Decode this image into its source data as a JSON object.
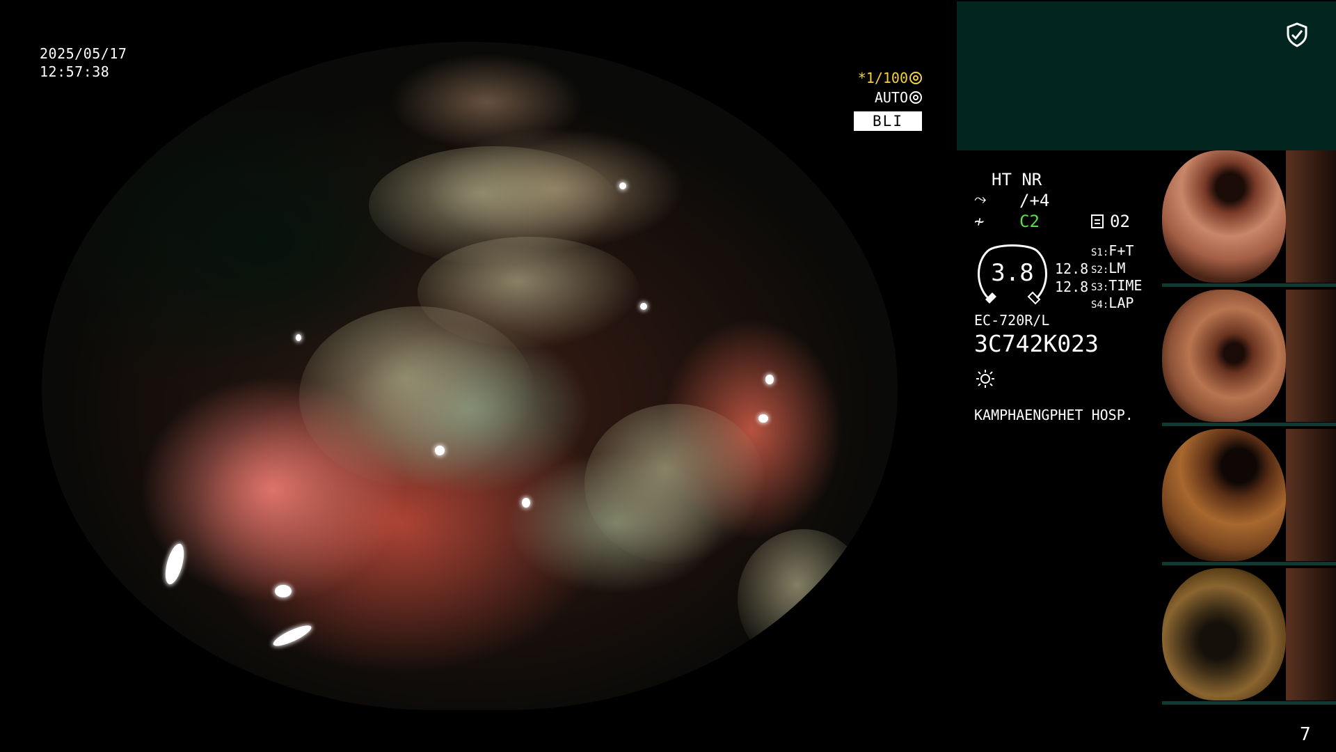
{
  "datetime": {
    "date": "2025/05/17",
    "time": "12:57:38"
  },
  "scope_overlay": {
    "shutter": "*1/100",
    "mode": "AUTO",
    "light_mode": "BLI"
  },
  "info": {
    "ht_nr": "HT NR",
    "enhancement": "/+4",
    "color_setting": "C2",
    "switch_number": "02",
    "gauge_value": "3.8",
    "mag_a": "12.8",
    "mag_b": "12.8",
    "switches": [
      {
        "key": "S1",
        "value": "F+T"
      },
      {
        "key": "S2",
        "value": "LM"
      },
      {
        "key": "S3",
        "value": "TIME"
      },
      {
        "key": "S4",
        "value": "LAP"
      }
    ],
    "scope_model": "EC-720R/L",
    "scope_serial": "3C742K023",
    "hospital": "KAMPHAENGPHET HOSP."
  },
  "thumbnails": [
    {
      "name": "capture-1"
    },
    {
      "name": "capture-2"
    },
    {
      "name": "capture-3"
    },
    {
      "name": "capture-4"
    }
  ],
  "page_number": "7",
  "colors": {
    "panel_bg": "#032520",
    "green_text": "#55e14a",
    "yellow_text": "#f5d23c"
  }
}
